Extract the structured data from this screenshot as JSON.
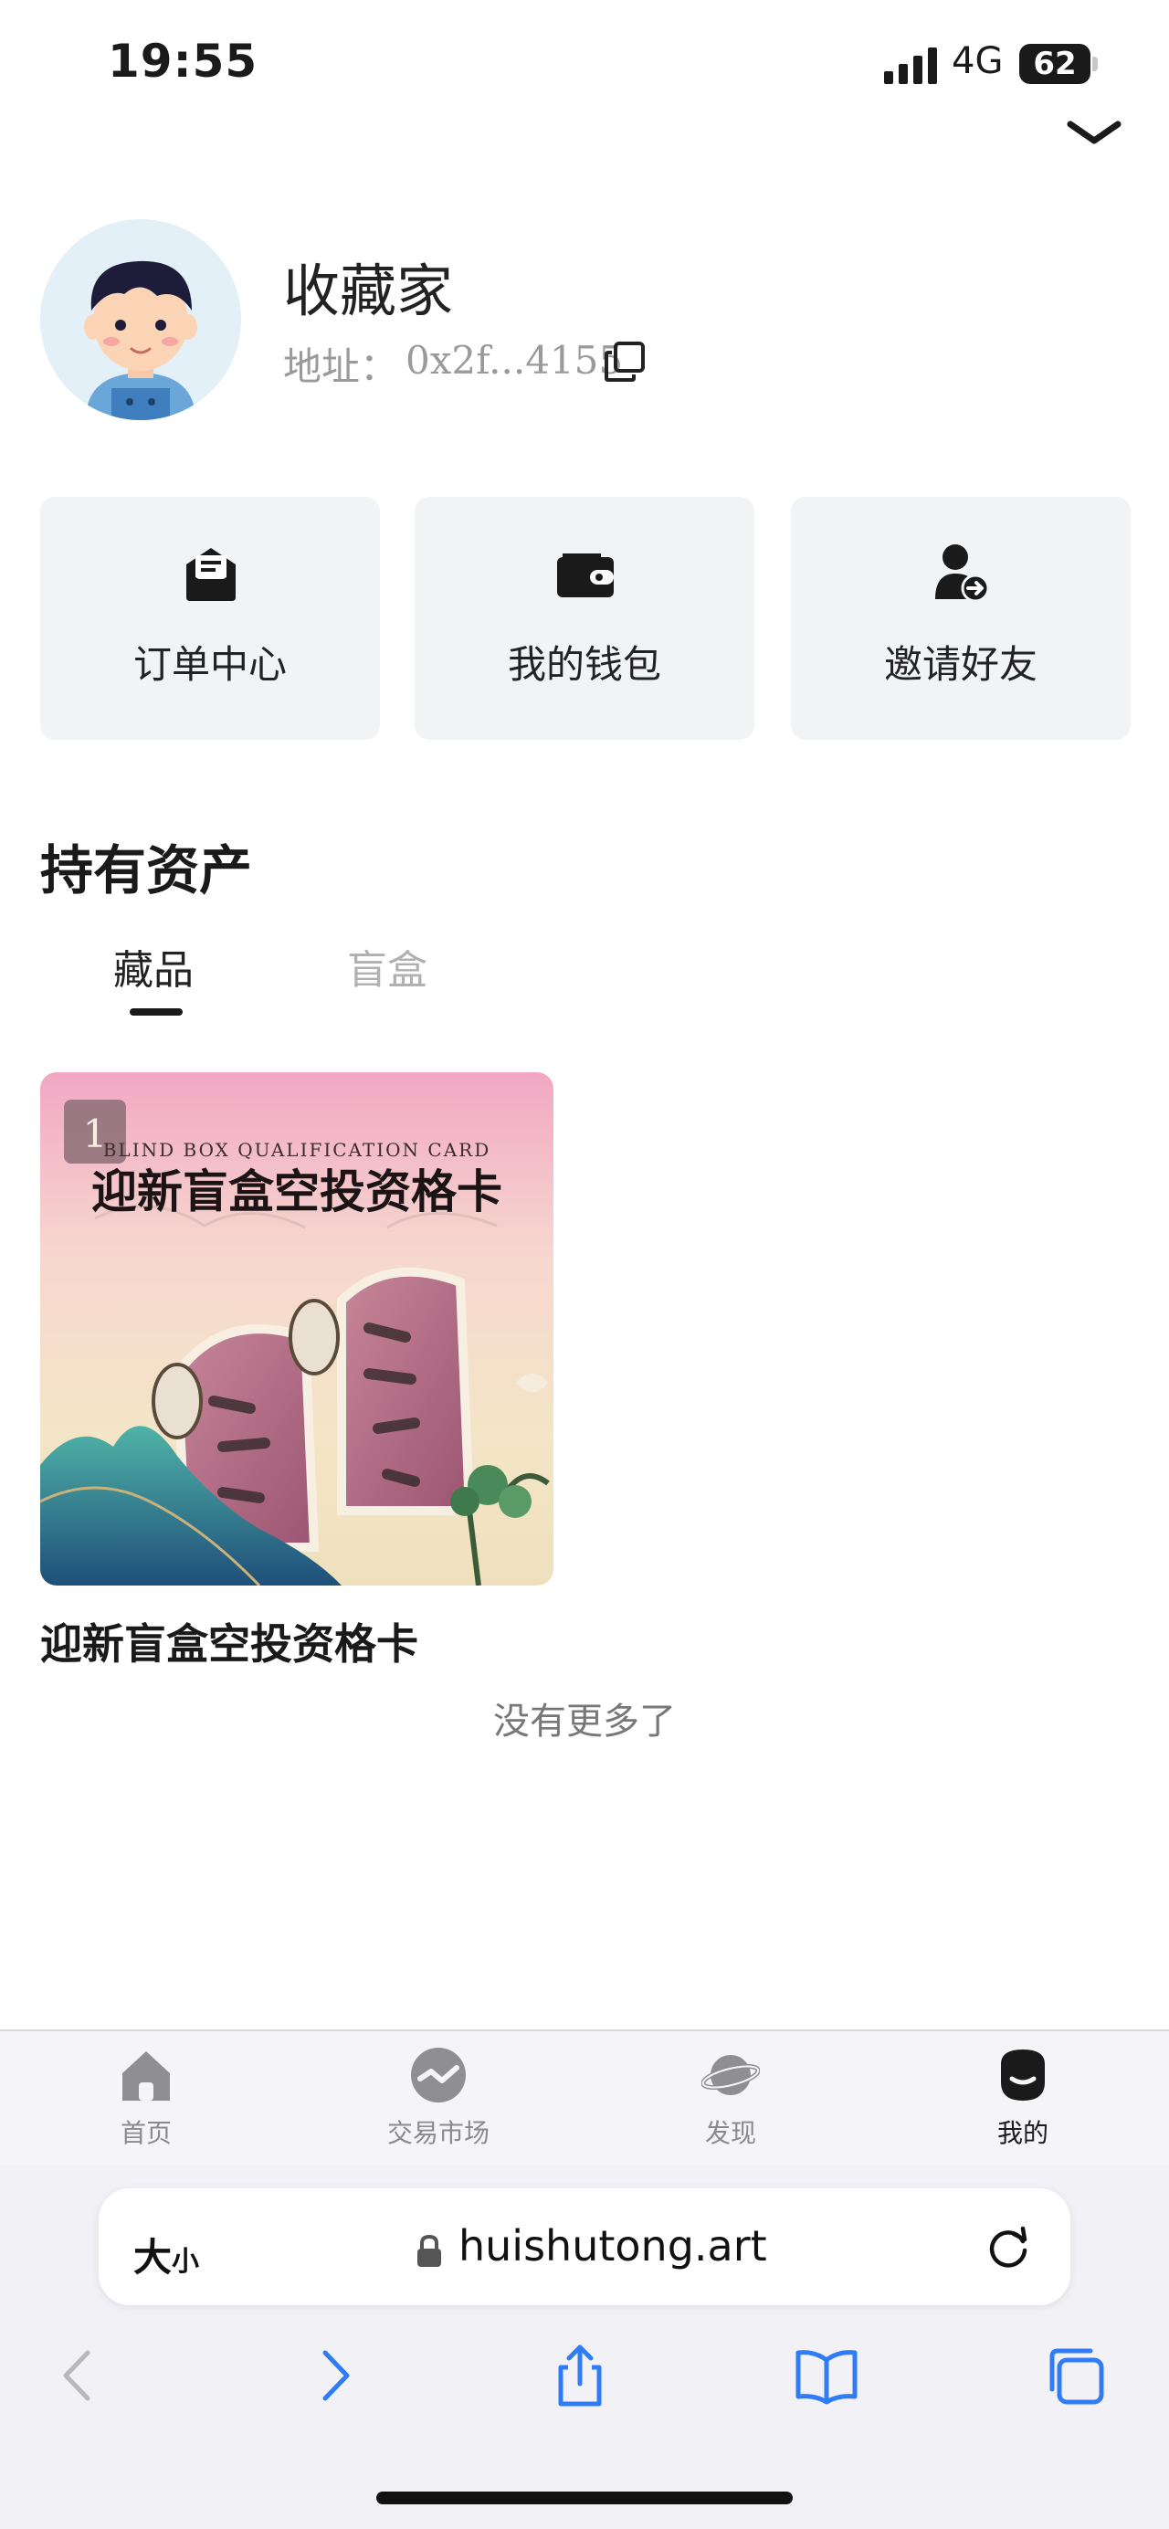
{
  "status_bar": {
    "time": "19:55",
    "network": "4G",
    "battery": "62"
  },
  "profile": {
    "name": "收藏家",
    "address_label": "地址：",
    "address_value": "0x2f...4155"
  },
  "quick_actions": [
    {
      "label": "订单中心",
      "icon": "order-icon"
    },
    {
      "label": "我的钱包",
      "icon": "wallet-icon"
    },
    {
      "label": "邀请好友",
      "icon": "invite-friend-icon"
    }
  ],
  "assets": {
    "title": "持有资产",
    "tabs": [
      {
        "label": "藏品",
        "active": true
      },
      {
        "label": "盲盒",
        "active": false
      }
    ],
    "items": [
      {
        "title": "迎新盲盒空投资格卡",
        "count_badge": "1",
        "image_caption_en": "BLIND BOX QUALIFICATION CARD",
        "image_caption_cn": "迎新盲盒空投资格卡"
      }
    ],
    "end_text": "没有更多了"
  },
  "tab_bar": [
    {
      "label": "首页",
      "icon": "home-icon",
      "active": false
    },
    {
      "label": "交易市场",
      "icon": "market-icon",
      "active": false
    },
    {
      "label": "发现",
      "icon": "planet-icon",
      "active": false
    },
    {
      "label": "我的",
      "icon": "profile-icon",
      "active": true
    }
  ],
  "browser": {
    "text_size_label": "大",
    "text_size_small": "小",
    "url": "huishutong.art"
  },
  "colors": {
    "background": "#ffffff",
    "card_background": "#f2f3f5",
    "muted_text": "#9a9a9a",
    "accent_blue": "#2f7cf6"
  }
}
